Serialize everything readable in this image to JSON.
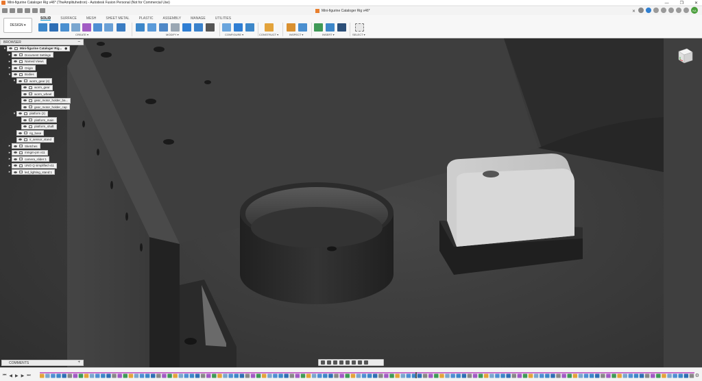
{
  "window": {
    "title": "Mini-figurine Cataloger Rig v46* (TheAmplituhedron) - Autodesk Fusion Personal (Not for Commercial Use)"
  },
  "document_tab": {
    "title": "Mini-figurine Cataloger Rig v46*"
  },
  "user_initials": "KA",
  "workspace": {
    "label": "DESIGN ▾"
  },
  "ribbon": {
    "tabs": [
      "SOLID",
      "SURFACE",
      "MESH",
      "SHEET METAL",
      "PLASTIC",
      "ASSEMBLY",
      "MANAGE",
      "UTILITIES"
    ],
    "active_tab": "SOLID",
    "groups": [
      "CREATE ▾",
      "MODIFY ▾",
      "CONFIGURE ▾",
      "CONSTRUCT ▾",
      "INSPECT ▾",
      "INSERT ▾",
      "SELECT ▾"
    ]
  },
  "browser": {
    "title": "BROWSER",
    "root": "Mini-figurine Cataloger Rig...",
    "items": [
      {
        "label": "Document Settings",
        "level": 1,
        "arrow": "▸"
      },
      {
        "label": "Named Views",
        "level": 1,
        "arrow": "▸"
      },
      {
        "label": "Origin",
        "level": 1,
        "arrow": "▸"
      },
      {
        "label": "Bodies",
        "level": 1,
        "arrow": "▾"
      },
      {
        "label": "worm_gear (4)",
        "level": 2,
        "arrow": "▾"
      },
      {
        "label": "worm_gear",
        "level": 3,
        "arrow": ""
      },
      {
        "label": "worm_wheel",
        "level": 3,
        "arrow": ""
      },
      {
        "label": "gear_motor_holder_ba...",
        "level": 3,
        "arrow": ""
      },
      {
        "label": "gear_motor_holder_cap",
        "level": 3,
        "arrow": ""
      },
      {
        "label": "platform (2)",
        "level": 2,
        "arrow": "▾"
      },
      {
        "label": "platform_main",
        "level": 3,
        "arrow": ""
      },
      {
        "label": "platform_shaft",
        "level": 3,
        "arrow": ""
      },
      {
        "label": "rig_base",
        "level": 2,
        "arrow": ""
      },
      {
        "label": "ir_sensor_stand",
        "level": 2,
        "arrow": ""
      },
      {
        "label": "Sketches",
        "level": 1,
        "arrow": "▸"
      },
      {
        "label": "mmgm-pm v11",
        "level": 1,
        "arrow": "▸"
      },
      {
        "label": "camera_slider:1",
        "level": 1,
        "arrow": "▸"
      },
      {
        "label": "UNO Q simplified v11",
        "level": 1,
        "arrow": "▸"
      },
      {
        "label": "led_lighting_stand:1",
        "level": 1,
        "arrow": "▸"
      }
    ]
  },
  "comments": {
    "label": "COMMENTS"
  },
  "colors": {
    "accent": "#0696d7",
    "viewport_bg": "#3b3b3b"
  }
}
